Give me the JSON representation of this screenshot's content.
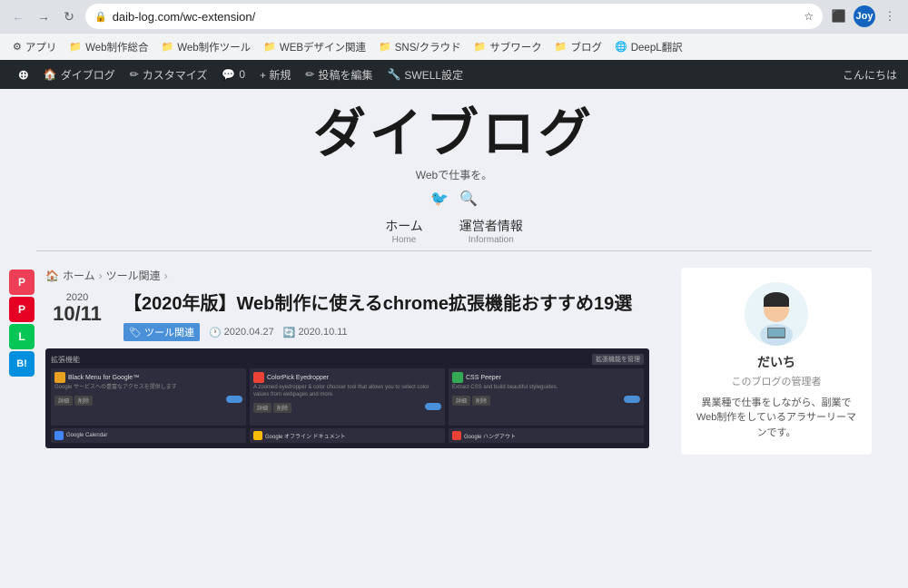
{
  "browser": {
    "back_btn": "←",
    "forward_btn": "→",
    "reload_btn": "↻",
    "url": "daib-log.com/wc-extension/",
    "star_icon": "☆",
    "extensions_icon": "⬛",
    "profile_icon": "Ae",
    "profile_label": "Joy"
  },
  "bookmarks": [
    {
      "label": "アプリ",
      "icon": "⚙"
    },
    {
      "label": "Web制作総合",
      "icon": "📁"
    },
    {
      "label": "Web制作ツール",
      "icon": "📁"
    },
    {
      "label": "WEBデザイン関連",
      "icon": "📁"
    },
    {
      "label": "SNS/クラウド",
      "icon": "📁"
    },
    {
      "label": "サブワーク",
      "icon": "📁"
    },
    {
      "label": "ブログ",
      "icon": "📁"
    },
    {
      "label": "DeepL翻訳",
      "icon": "🌐"
    }
  ],
  "wp_admin": {
    "wp_icon": "W",
    "items": [
      {
        "label": "ダイブログ",
        "icon": "🏠"
      },
      {
        "label": "カスタマイズ",
        "icon": "✏"
      },
      {
        "label": "0",
        "icon": "💬"
      },
      {
        "label": "+ 新規",
        "icon": ""
      },
      {
        "label": "投稿を編集",
        "icon": "✏"
      },
      {
        "label": "SWELL設定",
        "icon": "🔧"
      }
    ],
    "greeting": "こんにちは"
  },
  "blog": {
    "title": "ダイブログ",
    "tagline": "Webで仕事を。",
    "nav": [
      {
        "label": "ホーム",
        "sublabel": "Home"
      },
      {
        "label": "運営者情報",
        "sublabel": "Information"
      }
    ]
  },
  "breadcrumb": {
    "home": "ホーム",
    "sep1": "›",
    "category": "ツール関連",
    "sep2": "›"
  },
  "article": {
    "year": "2020",
    "date": "10/11",
    "title": "【2020年版】Web制作に使えるchrome拡張機能おすすめ19選",
    "tag": "ツール関連",
    "published": "2020.04.27",
    "updated": "2020.10.11",
    "thumbnail_header": "拡張機能",
    "thumbnail_header_right": "拡張機能を管理"
  },
  "sidebar_share": [
    {
      "icon": "P",
      "type": "pocket",
      "label": "Pocket"
    },
    {
      "icon": "P",
      "type": "pinterest",
      "label": "Pinterest"
    },
    {
      "icon": "L",
      "type": "line",
      "label": "Line"
    },
    {
      "icon": "B",
      "type": "hatena",
      "label": "Hatena"
    }
  ],
  "author": {
    "name": "だいち",
    "role": "このブログの管理者",
    "desc": "異業種で仕事をしながら、副業でWeb制作をしているアラサーリーマンです。"
  },
  "thumb_cards": [
    {
      "icon_color": "#e8a020",
      "title": "Black Menu for Google™",
      "desc": "Google サービスへの豊富なアクセスを提供します",
      "has_toggle": true
    },
    {
      "icon_color": "#ea4335",
      "title": "ColorPick Eyedropper",
      "desc": "A zoomed eyedropper & color chooser tool that allows you to select color values from webpages and more.",
      "has_toggle": true
    },
    {
      "icon_color": "#34a853",
      "title": "CSS Peeper",
      "desc": "Extract CSS and build beautiful styleguides.",
      "has_toggle": true
    }
  ]
}
